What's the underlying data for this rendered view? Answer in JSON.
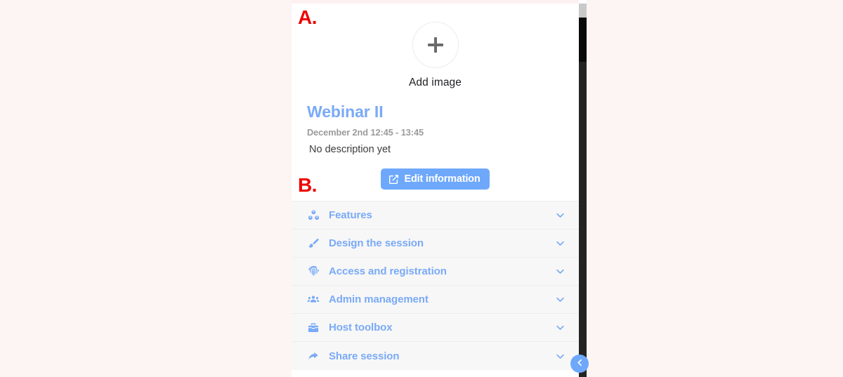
{
  "background_color": "#fdf4f4",
  "annotations": [
    {
      "id": "a",
      "label": "A."
    },
    {
      "id": "b",
      "label": "B."
    }
  ],
  "panel": {
    "accent_color": "#7aaaf7",
    "button_color": "#6ea8fb",
    "info": {
      "add_image_label": "Add image",
      "add_image_icon": "plus-icon",
      "title": "Webinar II",
      "datetime": "December 2nd 12:45 - 13:45",
      "description": "No description yet",
      "edit_button_label": "Edit information",
      "edit_button_icon": "edit-pencil-square-icon"
    },
    "accordion": {
      "items": [
        {
          "label": "Features",
          "icon": "cubes-icon",
          "chevron": "chevron-down-icon",
          "expanded": false
        },
        {
          "label": "Design the session",
          "icon": "paint-brush-icon",
          "chevron": "chevron-down-icon",
          "expanded": false
        },
        {
          "label": "Access and registration",
          "icon": "fingerprint-icon",
          "chevron": "chevron-down-icon",
          "expanded": false
        },
        {
          "label": "Admin management",
          "icon": "users-group-icon",
          "chevron": "chevron-down-icon",
          "expanded": false
        },
        {
          "label": "Host toolbox",
          "icon": "toolbox-icon",
          "chevron": "chevron-down-icon",
          "expanded": false
        },
        {
          "label": "Share session",
          "icon": "share-arrow-icon",
          "chevron": "chevron-down-icon",
          "expanded": false
        }
      ]
    },
    "collapse_button": {
      "icon": "chevron-left-icon",
      "color": "#6ea8fb"
    },
    "scrollbar": {
      "orientation": "vertical",
      "thumb_color": "#c9c9c9",
      "track_color": "#0a0a0a"
    }
  }
}
